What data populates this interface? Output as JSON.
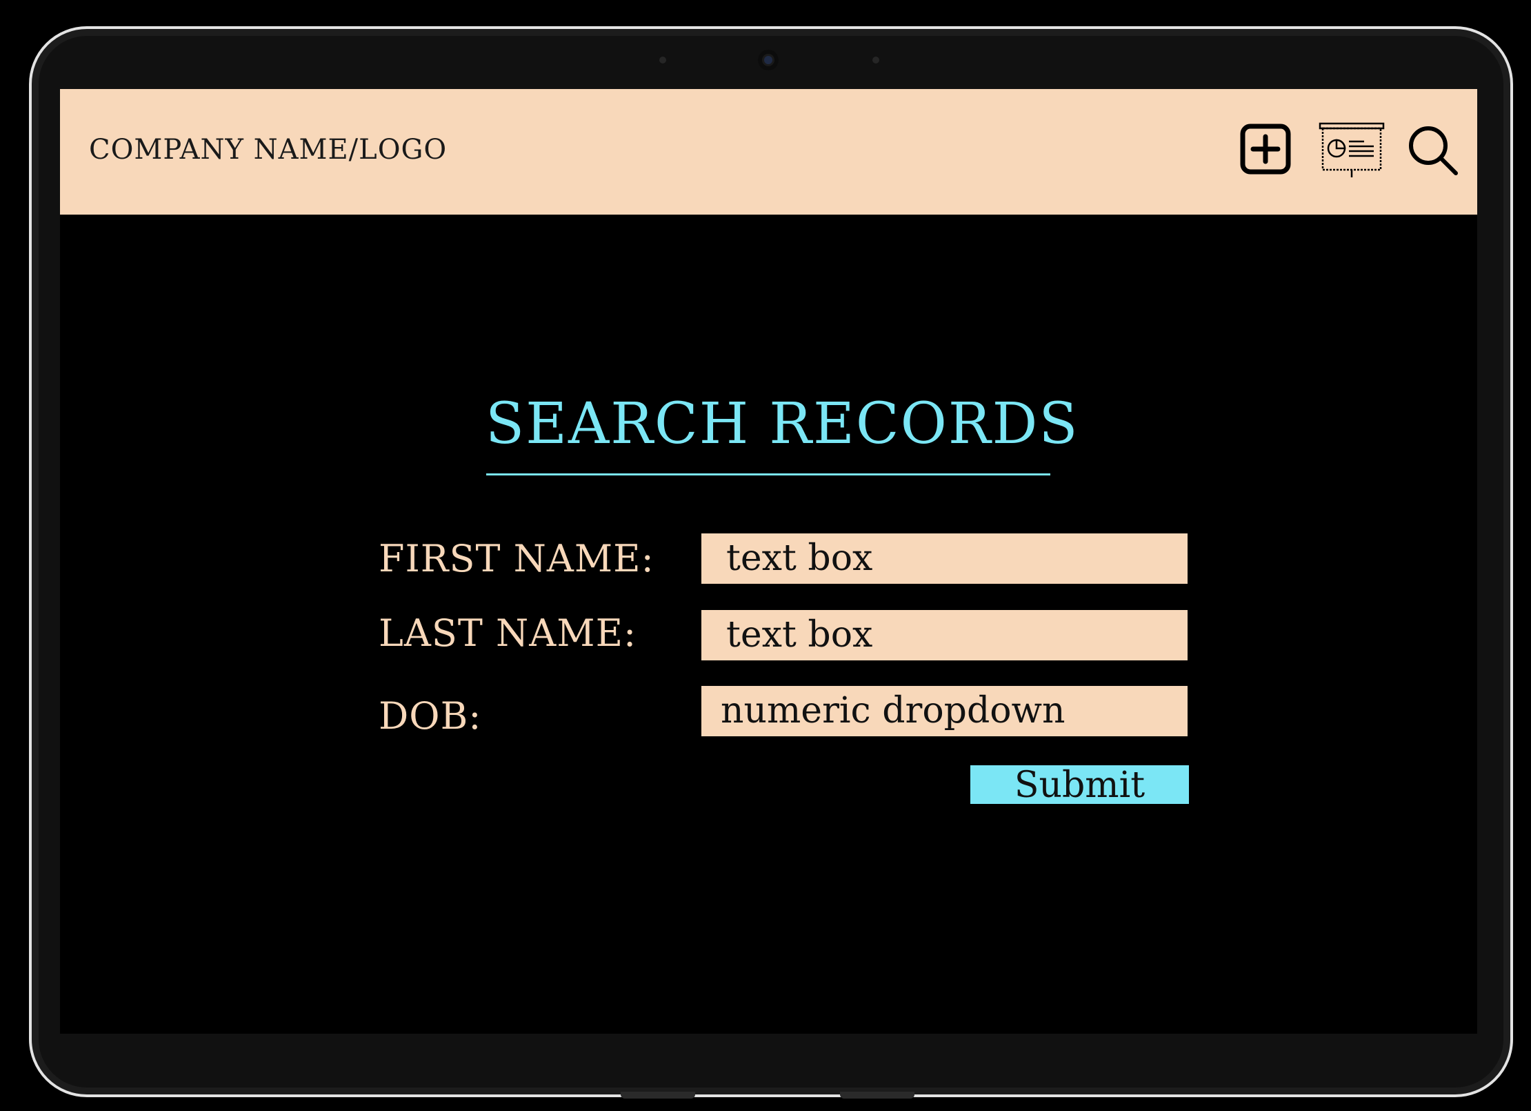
{
  "header": {
    "brand": "COMPANY NAME/LOGO",
    "icons": [
      "plus-square-icon",
      "presentation-chart-icon",
      "search-icon"
    ],
    "background": "#f8d8ba"
  },
  "main": {
    "title": "SEARCH RECORDS",
    "accent_color": "#7be6f5",
    "form": {
      "first_name_label": "FIRST NAME:",
      "first_name_value": "text box",
      "last_name_label": "LAST NAME:",
      "last_name_value": "text box",
      "dob_label": "DOB:",
      "dob_value": "numeric dropdown",
      "submit_label": "Submit"
    }
  }
}
